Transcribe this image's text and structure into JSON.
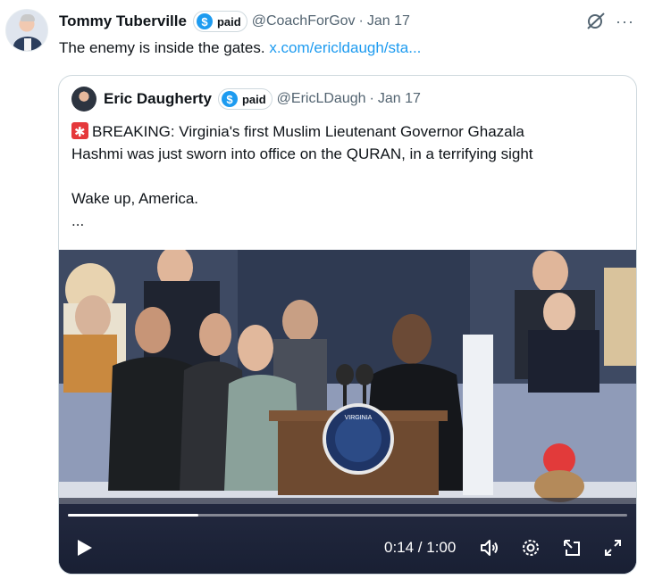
{
  "post": {
    "author_name": "Tommy Tuberville",
    "badge_label": "paid",
    "badge_symbol": "$",
    "handle": "@CoachForGov",
    "separator": "·",
    "date": "Jan 17",
    "text": "The enemy is inside the gates.",
    "link_text": "x.com/ericldaugh/sta...",
    "more_label": "···",
    "grok_icon": "grok-icon",
    "more_icon": "more-icon"
  },
  "quoted": {
    "author_name": "Eric Daugherty",
    "badge_label": "paid",
    "badge_symbol": "$",
    "handle": "@EricLDaugh",
    "separator": "·",
    "date": "Jan 17",
    "text_line1": "BREAKING: Virginia's first Muslim Lieutenant Governor Ghazala",
    "text_line2": "Hashmi was just sworn into office on the QURAN, in a terrifying sight",
    "text_line3": "Wake up, America.",
    "text_line4": "...",
    "emoji_icon": "police-light-icon"
  },
  "video": {
    "time_label": "0:14 / 1:00",
    "progress": 0.233,
    "seal_text": "VIRGINIA",
    "icons": [
      "play-icon",
      "volume-icon",
      "settings-icon",
      "pop-out-icon",
      "fullscreen-icon"
    ]
  },
  "colors": {
    "accent": "#1d9bf0",
    "text_primary": "#0f1419",
    "text_secondary": "#536471",
    "border": "#cfd9de"
  }
}
